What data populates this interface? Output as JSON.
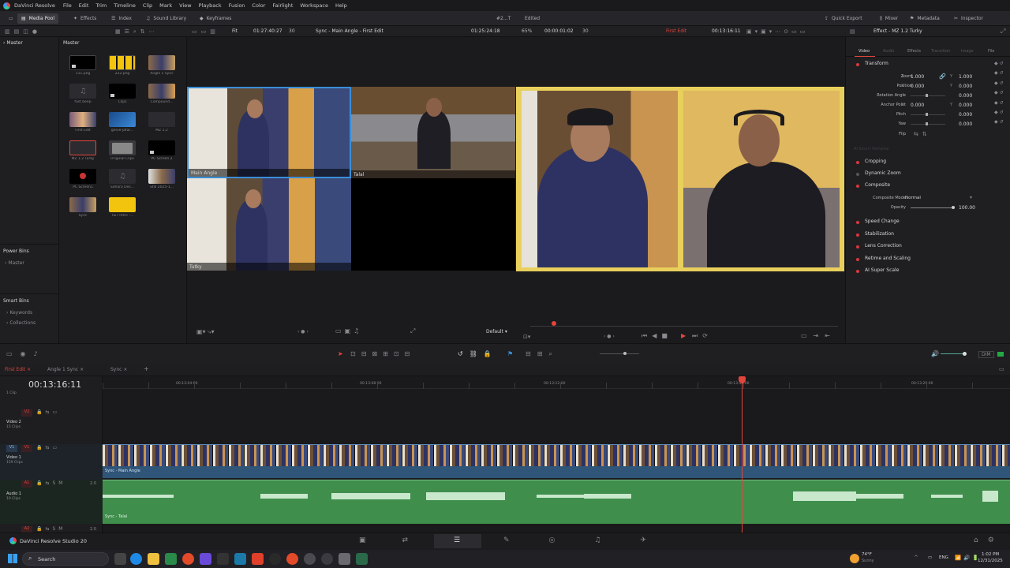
{
  "menubar": {
    "app": "DaVinci Resolve",
    "items": [
      "File",
      "Edit",
      "Trim",
      "Timeline",
      "Clip",
      "Mark",
      "View",
      "Playback",
      "Fusion",
      "Color",
      "Fairlight",
      "Workspace",
      "Help"
    ]
  },
  "toolbar": {
    "media_pool": "Media Pool",
    "effects": "Effects",
    "index": "Index",
    "sound_library": "Sound Library",
    "keyframes": "Keyframes",
    "project": "#2...T",
    "status": "Edited",
    "quick_export": "Quick Export",
    "mixer": "Mixer",
    "metadata": "Metadata",
    "inspector": "Inspector"
  },
  "subtoolbar": {
    "fit": "Fit",
    "src_tc": "01:27:40:27",
    "src_fps": "30",
    "source_name": "Sync - Main Angle - First Edit",
    "rec_tc": "01:25:24:18",
    "zoom": "65%",
    "dur": "00:00:01:02",
    "rec_fps": "30",
    "timeline_name": "First Edit",
    "tl_tc": "00:13:16:11",
    "effect_title": "Effect - MZ 1.2 Turky"
  },
  "sidebar": {
    "master": "Master",
    "power_bins": "Power Bins",
    "power_master": "Master",
    "smart_bins": "Smart Bins",
    "keywords": "Keywords",
    "collections": "Collections"
  },
  "pool": {
    "title": "Master",
    "clips": [
      {
        "label": "111.png"
      },
      {
        "label": "222.png"
      },
      {
        "label": "Angle 1 Sync"
      },
      {
        "label": "fast beep"
      },
      {
        "label": "Clips"
      },
      {
        "label": "Compound..."
      },
      {
        "label": "First Edit"
      },
      {
        "label": "genie-jafar..."
      },
      {
        "label": "MZ 1.2"
      },
      {
        "label": "MZ 1.2 Turky"
      },
      {
        "label": "Original Clips"
      },
      {
        "label": "PC Screen 2"
      },
      {
        "label": "PC Screen1"
      },
      {
        "label": "Sahara Des..."
      },
      {
        "label": "Still 2025-1..."
      },
      {
        "label": "Sync"
      },
      {
        "label": "T&T Intro -..."
      }
    ]
  },
  "viewer": {
    "angle1": "Main Angle",
    "angle2": "Talal",
    "angle3": "Tutky",
    "view_mode": "Default"
  },
  "inspector": {
    "tabs": [
      "Video",
      "Audio",
      "Effects",
      "Transition",
      "Image",
      "File"
    ],
    "transform": "Transform",
    "zoom_label": "Zoom",
    "zoom_x": "1.000",
    "zoom_y": "1.000",
    "position_label": "Position",
    "pos_x": "0.000",
    "pos_y": "0.000",
    "rotation_label": "Rotation Angle",
    "rotation": "0.000",
    "anchor_label": "Anchor Point",
    "anchor_x": "0.000",
    "anchor_y": "0.000",
    "pitch_label": "Pitch",
    "pitch": "0.000",
    "yaw_label": "Yaw",
    "yaw": "0.000",
    "flip_label": "Flip",
    "smart_reframe": "AI Smart Reframe",
    "cropping": "Cropping",
    "dynamic_zoom": "Dynamic Zoom",
    "composite": "Composite",
    "composite_mode_label": "Composite Mode",
    "composite_mode": "Normal",
    "opacity_label": "Opacity",
    "opacity": "100.00",
    "speed_change": "Speed Change",
    "stabilization": "Stabilization",
    "lens_correction": "Lens Correction",
    "retime_scaling": "Retime and Scaling",
    "ai_super_scale": "AI Super Scale"
  },
  "timeline": {
    "tabs": [
      "First Edit",
      "Angle 1 Sync",
      "Sync"
    ],
    "timecode": "00:13:16:11",
    "ruler": [
      "00:13:04:00",
      "00:13:08:00",
      "00:13:12:00",
      "00:13:16:00",
      "00:13:20:00"
    ],
    "clip_label": "1 Clip",
    "v2": "V2",
    "v2_name": "Video 2",
    "v2_clips": "15 Clips",
    "v1": "V1",
    "v1_name": "Video 1",
    "v1_clips": "159 Clips",
    "a1": "A1",
    "a1_name": "Audio 1",
    "a1_clips": "10 Clips",
    "a1_level": "2.0",
    "a2": "A2",
    "a2_level": "2.0",
    "video_clip": "Sync - Main Angle",
    "audio_clip": "Sync - Talal",
    "dim": "DIM"
  },
  "bottom": {
    "product": "DaVinci Resolve Studio 20"
  },
  "taskbar": {
    "search": "Search",
    "weather_temp": "74°F",
    "weather_desc": "Sunny",
    "lang": "ENG",
    "time": "1:02 PM",
    "date": "12/31/2025"
  },
  "colors": {
    "accent_red": "#e2453c",
    "audio_green": "#3f8e4c",
    "video_blue": "#3b6c97",
    "yellow_border": "#e9cf5c"
  }
}
